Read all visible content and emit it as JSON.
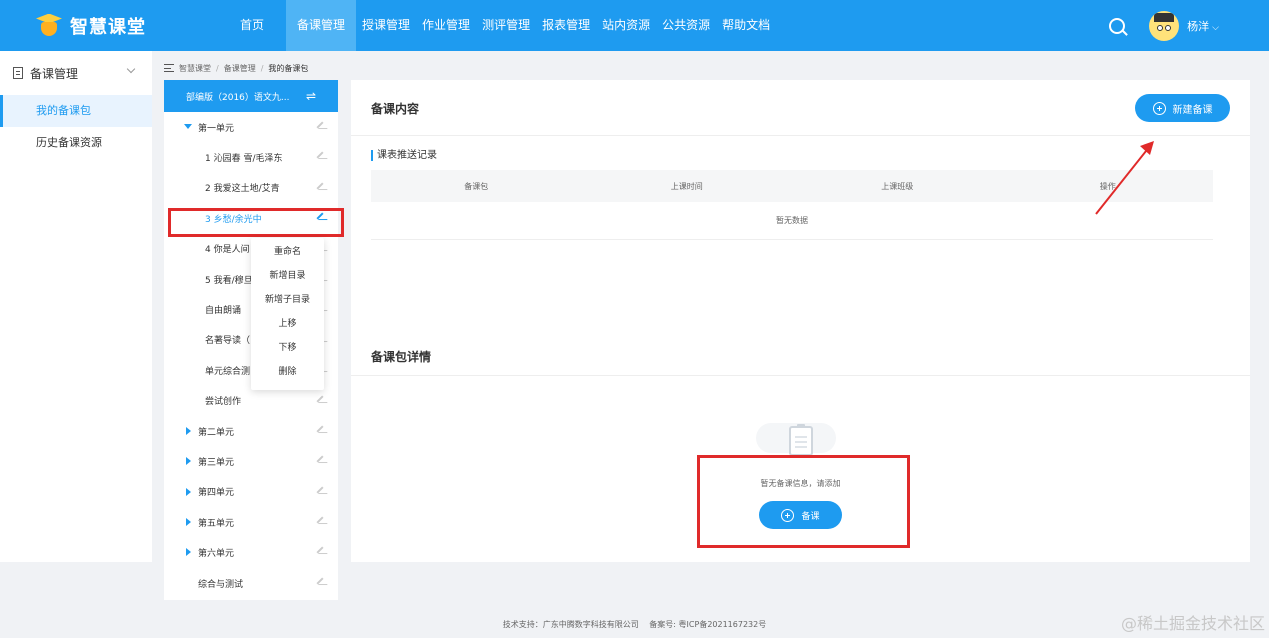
{
  "brand": {
    "title": "智慧课堂"
  },
  "nav": {
    "home": "首页",
    "items": [
      "备课管理",
      "授课管理",
      "作业管理",
      "测评管理",
      "报表管理",
      "站内资源",
      "公共资源",
      "帮助文档"
    ]
  },
  "user": {
    "name": "杨洋",
    "chevron": "⌵"
  },
  "sidebar": {
    "group": "备课管理",
    "items": [
      "我的备课包",
      "历史备课资源"
    ]
  },
  "breadcrumb": [
    "智慧课堂",
    "备课管理",
    "我的备课包"
  ],
  "tree": {
    "header": "部编版（2016）语文九...",
    "swap": "⇌",
    "unit1": "第一单元",
    "lessons": [
      "1 沁园春 雪/毛泽东",
      "2 我爱这土地/艾青",
      "3 乡愁/余光中",
      "4 你是人间",
      "5 我看/穆旦",
      "自由朗诵",
      "名著导读（",
      "单元综合测",
      "尝试创作"
    ],
    "units": [
      "第二单元",
      "第三单元",
      "第四单元",
      "第五单元",
      "第六单元"
    ],
    "last": "综合与测试"
  },
  "context_menu": [
    "重命名",
    "新增目录",
    "新增子目录",
    "上移",
    "下移",
    "删除"
  ],
  "main": {
    "content_title": "备课内容",
    "new_button": "新建备课",
    "push_title": "课表推送记录",
    "columns": [
      "备课包",
      "上课时间",
      "上课班级",
      "操作"
    ],
    "no_data": "暂无数据",
    "detail_title": "备课包详情",
    "empty_text": "暂无备课信息，请添加",
    "prep_button": "备课"
  },
  "footer": "技术支持：广东中腾数字科技有限公司　 备案号: 粤ICP备2021167232号",
  "watermark": "@稀土掘金技术社区",
  "colors": {
    "primary": "#1e9bf0",
    "highlight": "#e02a2a"
  }
}
